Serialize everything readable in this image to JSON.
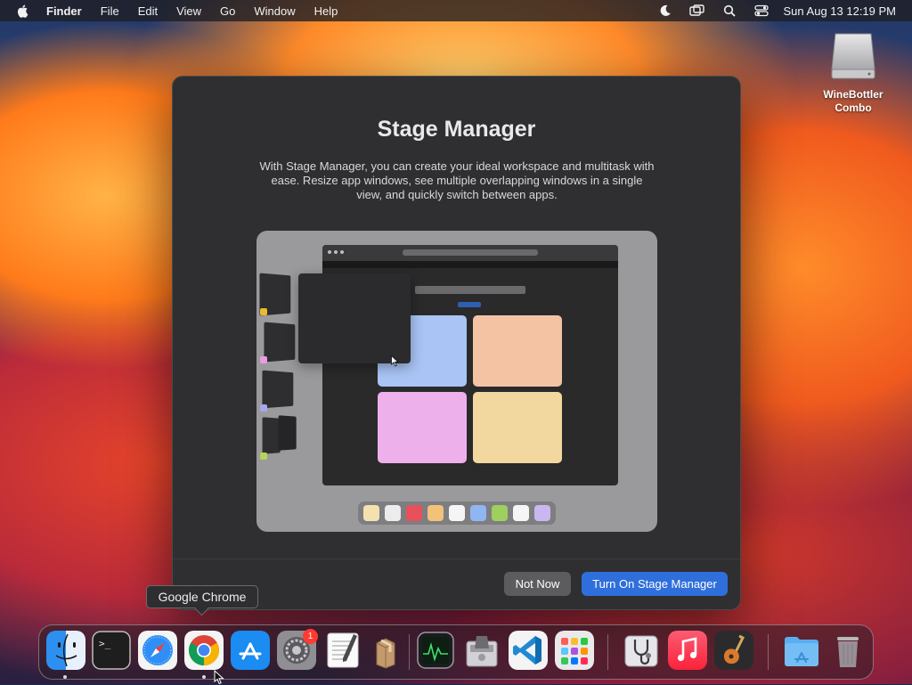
{
  "menubar": {
    "app_name": "Finder",
    "items": [
      "File",
      "Edit",
      "View",
      "Go",
      "Window",
      "Help"
    ],
    "status_icons": [
      "moon-icon",
      "screen-mirroring-icon",
      "search-icon",
      "control-center-icon"
    ],
    "clock": "Sun Aug 13  12:19 PM"
  },
  "desktop": {
    "icon_label_line1": "WineBottler",
    "icon_label_line2": "Combo",
    "icon": "removable-drive-icon"
  },
  "dialog": {
    "title": "Stage Manager",
    "description": "With Stage Manager, you can create your ideal workspace and multitask with ease. Resize app windows, see multiple overlapping windows in a single view, and quickly switch between apps.",
    "not_now_label": "Not Now",
    "turn_on_label": "Turn On Stage Manager"
  },
  "illustration": {
    "tile_colors": [
      "#a9c4f5",
      "#f4c3a4",
      "#eeb0ea",
      "#f2d89f"
    ],
    "stage_dot_colors": [
      "#f0b92a",
      "#e99be6",
      "#a9a6ec",
      "#b6d45a"
    ],
    "mini_dock_colors": [
      "#f3e2b0",
      "#ececec",
      "#e8505b",
      "#f2c278",
      "#f5f5f5",
      "#8fb6f3",
      "#9fcf5e",
      "#f5f5f5",
      "#c9b8f0"
    ]
  },
  "tooltip": {
    "text": "Google Chrome"
  },
  "dock": {
    "apps": [
      "Finder",
      "Terminal",
      "Safari",
      "Google Chrome",
      "App Store",
      "System Settings",
      "TextEdit",
      "Archive Utility",
      "Activity Monitor",
      "Disk Utility",
      "Visual Studio Code",
      "Launchpad",
      "Disk Utility First Aid",
      "Music",
      "GarageBand",
      "Applications",
      "Trash"
    ],
    "settings_badge": "1"
  },
  "colors": {
    "primary_button": "#2f6fdc",
    "secondary_button": "#5c5c5f",
    "dialog_bg": "#2f2f31"
  }
}
